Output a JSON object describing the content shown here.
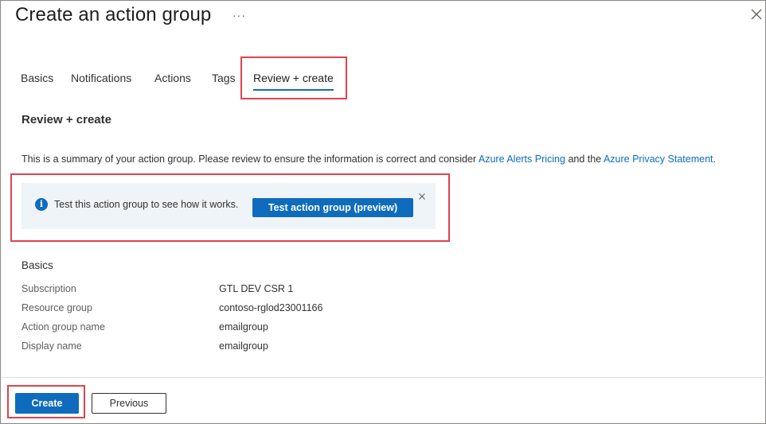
{
  "header": {
    "title": "Create an action group",
    "more_label": "···"
  },
  "tabs": [
    {
      "label": "Basics"
    },
    {
      "label": "Notifications"
    },
    {
      "label": "Actions"
    },
    {
      "label": "Tags"
    },
    {
      "label": "Review + create"
    }
  ],
  "review": {
    "section_title": "Review + create",
    "summary_prefix": "This is a summary of your action group. Please review to ensure the information is correct and consider ",
    "pricing_link": "Azure Alerts Pricing",
    "summary_mid": " and the ",
    "privacy_link": "Azure Privacy Statement",
    "summary_suffix": "."
  },
  "info_bar": {
    "icon": "info-icon",
    "message": "Test this action group to see how it works.",
    "button_label": "Test action group (preview)"
  },
  "basics": {
    "title": "Basics",
    "rows": [
      {
        "label": "Subscription",
        "value": "GTL DEV CSR 1"
      },
      {
        "label": "Resource group",
        "value": "contoso-rglod23001166"
      },
      {
        "label": "Action group name",
        "value": "emailgroup"
      },
      {
        "label": "Display name",
        "value": "emailgroup"
      }
    ]
  },
  "footer": {
    "create_label": "Create",
    "previous_label": "Previous"
  },
  "colors": {
    "accent": "#0f6cbd",
    "highlight": "#e0434d",
    "info_background": "#eff4f9"
  }
}
